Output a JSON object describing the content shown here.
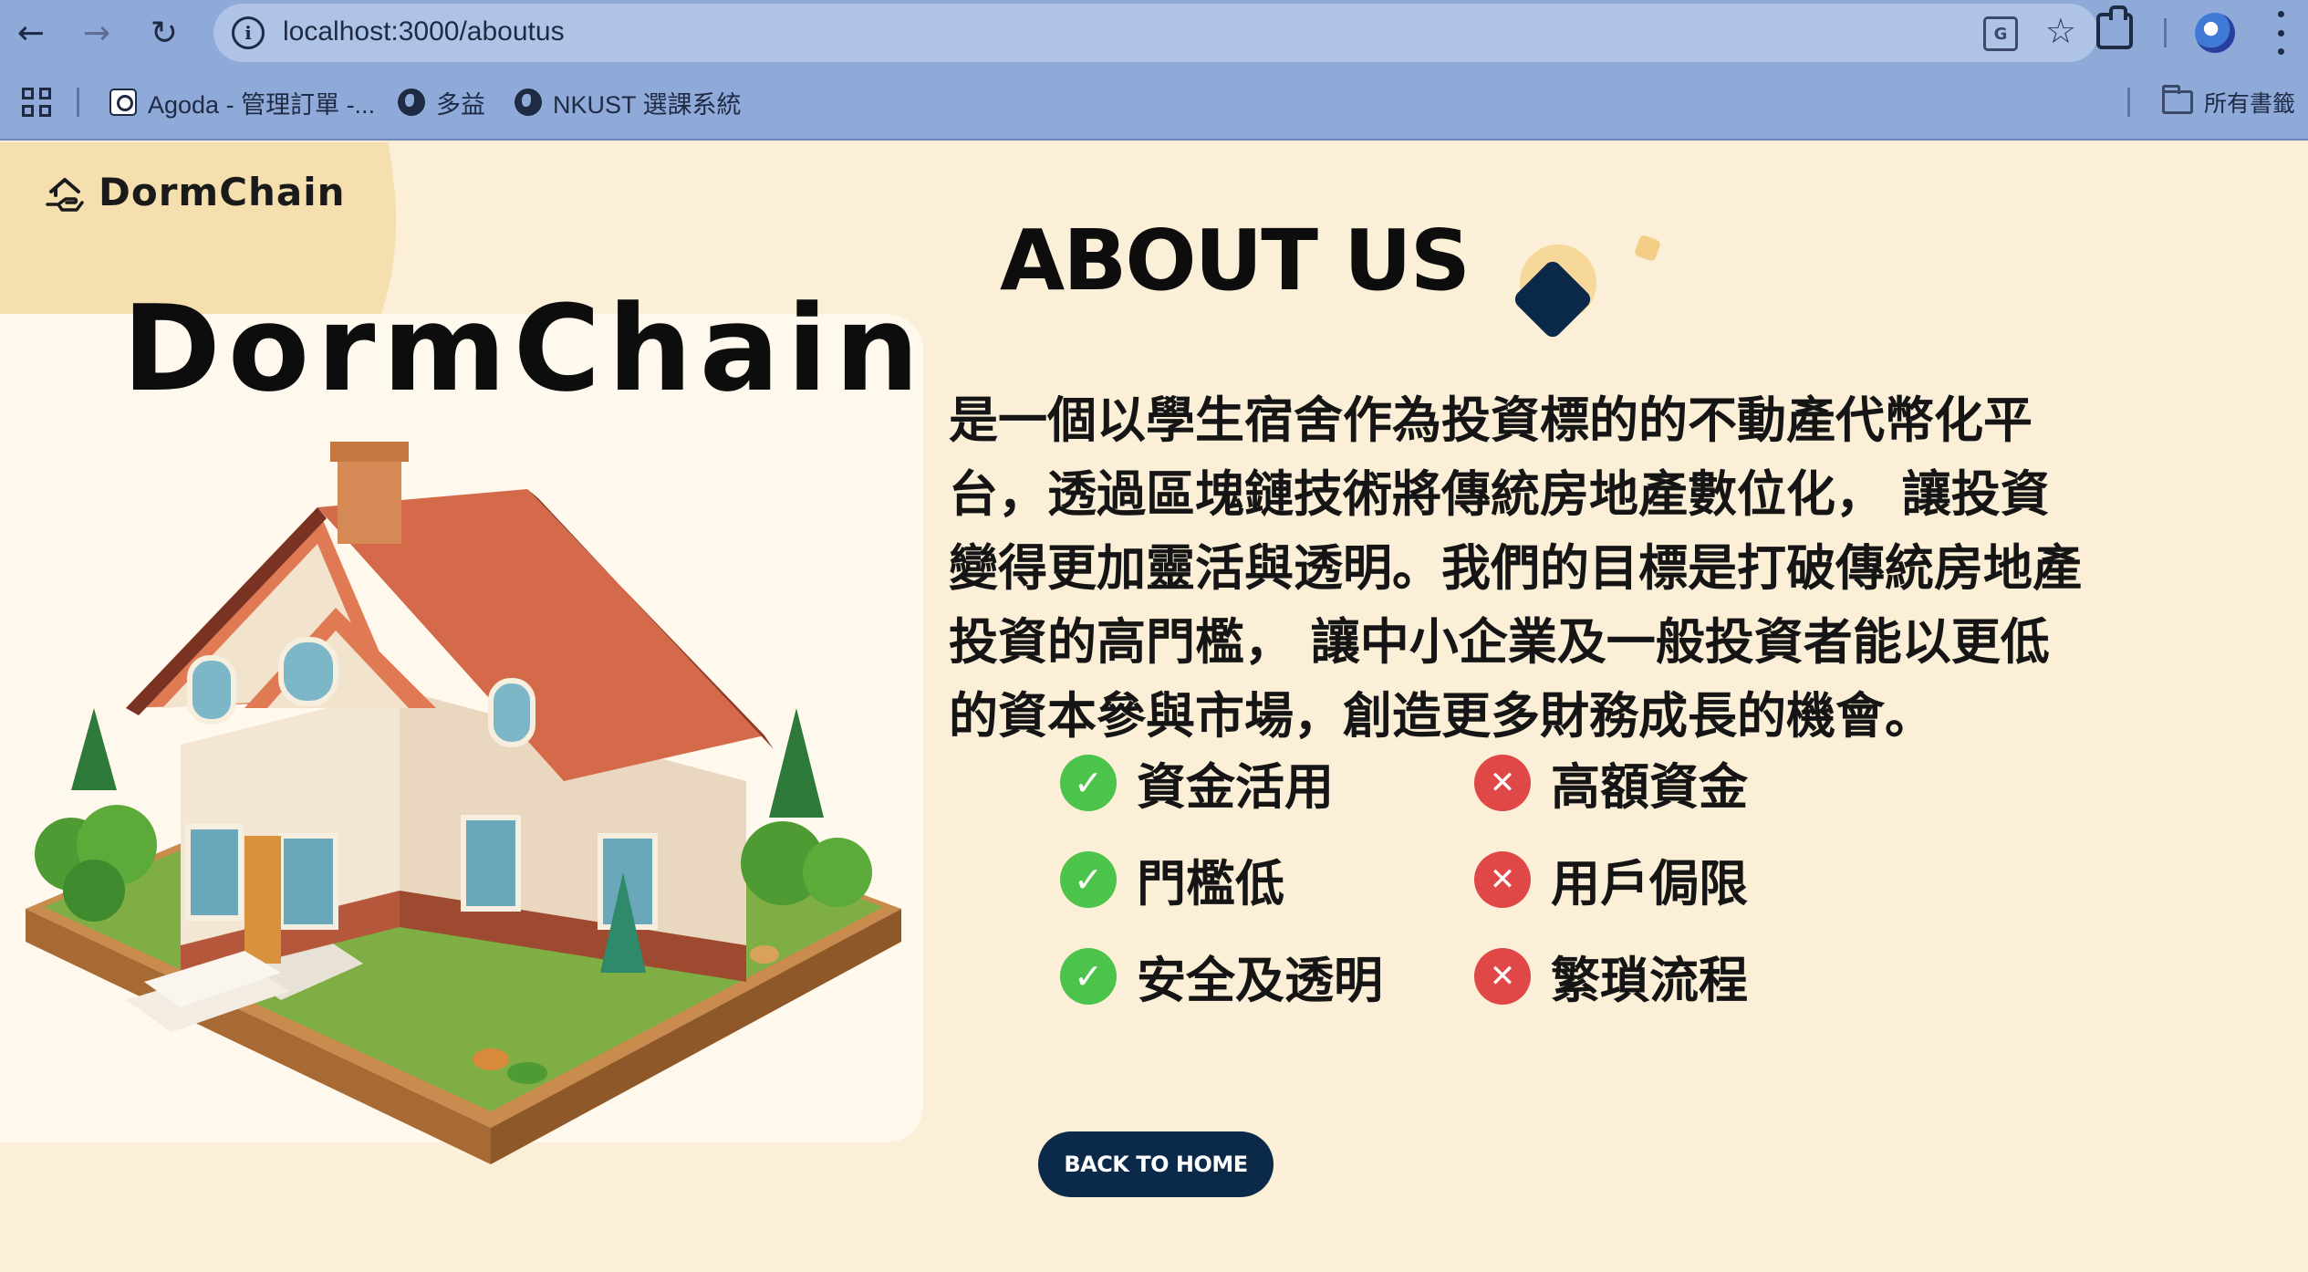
{
  "browser": {
    "url": "localhost:3000/aboutus",
    "bookmarks": [
      {
        "label": "Agoda - 管理訂單 -...",
        "icon": "agoda-favicon-icon"
      },
      {
        "label": "多益",
        "icon": "globe-icon"
      },
      {
        "label": "NKUST 選課系統",
        "icon": "globe-icon"
      }
    ],
    "all_bookmarks_label": "所有書籤"
  },
  "brand": {
    "name": "DormChain",
    "icon": "house-hand-icon"
  },
  "hero": {
    "title": "DormChain",
    "image": "3d-house-illustration"
  },
  "about": {
    "title": "ABOUT US",
    "description": "是一個以學生宿舍作為投資標的的不動產代幣化平台，透過區塊鏈技術將傳統房地產數位化， 讓投資變得更加靈活與透明。我們的目標是打破傳統房地產投資的高門檻， 讓中小企業及一般投資者能以更低的資本參與市場，創造更多財務成長的機會。"
  },
  "features": {
    "pros": [
      "資金活用",
      "門檻低",
      "安全及透明"
    ],
    "cons": [
      "高額資金",
      "用戶侷限",
      "繁瑣流程"
    ]
  },
  "back_button": {
    "label": "BACK TO HOME"
  },
  "colors": {
    "page_bg": "#FCEFD8",
    "card_bg": "#FFF8EC",
    "accent_navy": "#0B2A4A",
    "check_green": "#4CC34A",
    "cross_red": "#E04848",
    "browser_chrome": "#8FAAD9"
  }
}
